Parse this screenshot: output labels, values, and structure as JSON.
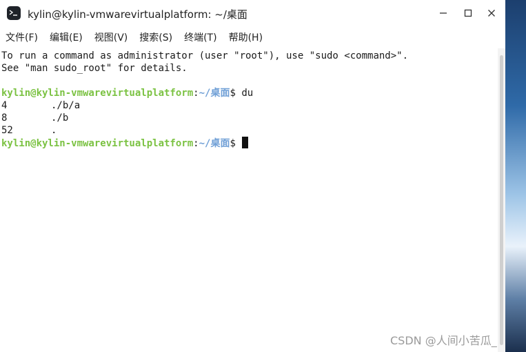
{
  "window": {
    "title": "kylin@kylin-vmwarevirtualplatform: ~/桌面",
    "icon": "terminal-icon"
  },
  "menu": [
    {
      "label": "文件(F)"
    },
    {
      "label": "编辑(E)"
    },
    {
      "label": "视图(V)"
    },
    {
      "label": "搜索(S)"
    },
    {
      "label": "终端(T)"
    },
    {
      "label": "帮助(H)"
    }
  ],
  "terminal": {
    "intro1": "To run a command as administrator (user \"root\"), use \"sudo <command>\".",
    "intro2": "See \"man sudo_root\" for details.",
    "prompt1": {
      "user": "kylin@kylin-vmwarevirtualplatform",
      "colon": ":",
      "path": "~/桌面",
      "symbol": "$ ",
      "command": "du"
    },
    "output": [
      {
        "size": "4",
        "path": "./b/a"
      },
      {
        "size": "8",
        "path": "./b"
      },
      {
        "size": "52",
        "path": "."
      }
    ],
    "prompt2": {
      "user": "kylin@kylin-vmwarevirtualplatform",
      "colon": ":",
      "path": "~/桌面",
      "symbol": "$ "
    }
  },
  "watermark": "CSDN @人间小苦瓜_"
}
